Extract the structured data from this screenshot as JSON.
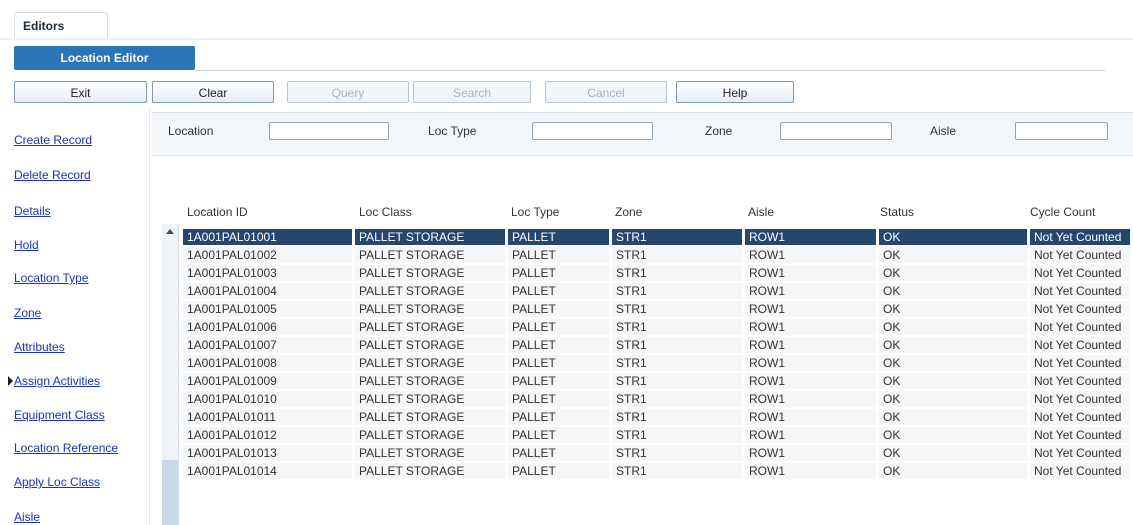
{
  "tabs": {
    "editors": "Editors",
    "location_editor": "Location Editor"
  },
  "toolbar": {
    "exit": "Exit",
    "clear": "Clear",
    "query": "Query",
    "search": "Search",
    "cancel": "Cancel",
    "help": "Help"
  },
  "sidebar": {
    "items": [
      "Create Record",
      "Delete Record",
      "Details",
      "Hold",
      "Location Type",
      "Zone",
      "Attributes",
      "Assign Activities",
      "Equipment Class",
      "Location Reference",
      "Apply Loc Class",
      "Aisle"
    ]
  },
  "filters": {
    "location": {
      "label": "Location",
      "value": ""
    },
    "loc_type": {
      "label": "Loc Type",
      "value": ""
    },
    "zone": {
      "label": "Zone",
      "value": ""
    },
    "aisle": {
      "label": "Aisle",
      "value": ""
    }
  },
  "grid": {
    "headers": [
      "Location ID",
      "Loc Class",
      "Loc Type",
      "Zone",
      "Aisle",
      "Status",
      "Cycle Count"
    ],
    "rows": [
      [
        "1A001PAL01001",
        "PALLET STORAGE",
        "PALLET",
        "STR1",
        "ROW1",
        "OK",
        "Not Yet Counted"
      ],
      [
        "1A001PAL01002",
        "PALLET STORAGE",
        "PALLET",
        "STR1",
        "ROW1",
        "OK",
        "Not Yet Counted"
      ],
      [
        "1A001PAL01003",
        "PALLET STORAGE",
        "PALLET",
        "STR1",
        "ROW1",
        "OK",
        "Not Yet Counted"
      ],
      [
        "1A001PAL01004",
        "PALLET STORAGE",
        "PALLET",
        "STR1",
        "ROW1",
        "OK",
        "Not Yet Counted"
      ],
      [
        "1A001PAL01005",
        "PALLET STORAGE",
        "PALLET",
        "STR1",
        "ROW1",
        "OK",
        "Not Yet Counted"
      ],
      [
        "1A001PAL01006",
        "PALLET STORAGE",
        "PALLET",
        "STR1",
        "ROW1",
        "OK",
        "Not Yet Counted"
      ],
      [
        "1A001PAL01007",
        "PALLET STORAGE",
        "PALLET",
        "STR1",
        "ROW1",
        "OK",
        "Not Yet Counted"
      ],
      [
        "1A001PAL01008",
        "PALLET STORAGE",
        "PALLET",
        "STR1",
        "ROW1",
        "OK",
        "Not Yet Counted"
      ],
      [
        "1A001PAL01009",
        "PALLET STORAGE",
        "PALLET",
        "STR1",
        "ROW1",
        "OK",
        "Not Yet Counted"
      ],
      [
        "1A001PAL01010",
        "PALLET STORAGE",
        "PALLET",
        "STR1",
        "ROW1",
        "OK",
        "Not Yet Counted"
      ],
      [
        "1A001PAL01011",
        "PALLET STORAGE",
        "PALLET",
        "STR1",
        "ROW1",
        "OK",
        "Not Yet Counted"
      ],
      [
        "1A001PAL01012",
        "PALLET STORAGE",
        "PALLET",
        "STR1",
        "ROW1",
        "OK",
        "Not Yet Counted"
      ],
      [
        "1A001PAL01013",
        "PALLET STORAGE",
        "PALLET",
        "STR1",
        "ROW1",
        "OK",
        "Not Yet Counted"
      ],
      [
        "1A001PAL01014",
        "PALLET STORAGE",
        "PALLET",
        "STR1",
        "ROW1",
        "OK",
        "Not Yet Counted"
      ]
    ]
  },
  "colors": {
    "accent": "#2a74b8",
    "selected_row": "#25466e",
    "link": "#1a34b8"
  }
}
